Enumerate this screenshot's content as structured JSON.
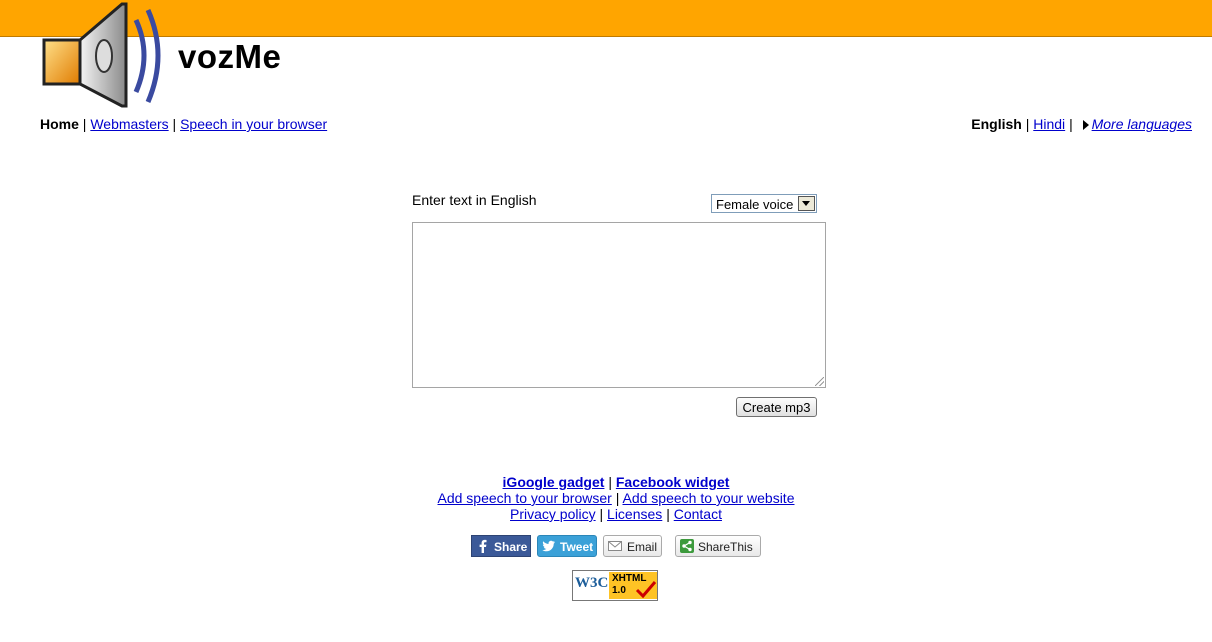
{
  "header": {
    "brand": "vozMe",
    "logo_icon": "speaker-icon",
    "bar_color": "#ffa500"
  },
  "nav_left": {
    "home": "Home",
    "webmasters": "Webmasters",
    "speech_browser": "Speech in your browser"
  },
  "nav_right": {
    "english": "English",
    "hindi": "Hindi",
    "more_languages": "More languages"
  },
  "form": {
    "prompt": "Enter text in English",
    "voice_selected": "Female voice",
    "textarea_value": "",
    "create_button": "Create mp3"
  },
  "footer": {
    "igoogle": "iGoogle gadget",
    "facebook": "Facebook widget",
    "add_browser": "Add speech to your browser",
    "add_website": "Add speech to your website",
    "privacy": "Privacy policy",
    "licenses": "Licenses",
    "contact": "Contact"
  },
  "share": {
    "facebook": "Share",
    "twitter": "Tweet",
    "email": "Email",
    "sharethis": "ShareThis"
  },
  "badge": {
    "w3c": "W3C",
    "xhtml": "XHTML",
    "version": "1.0"
  }
}
